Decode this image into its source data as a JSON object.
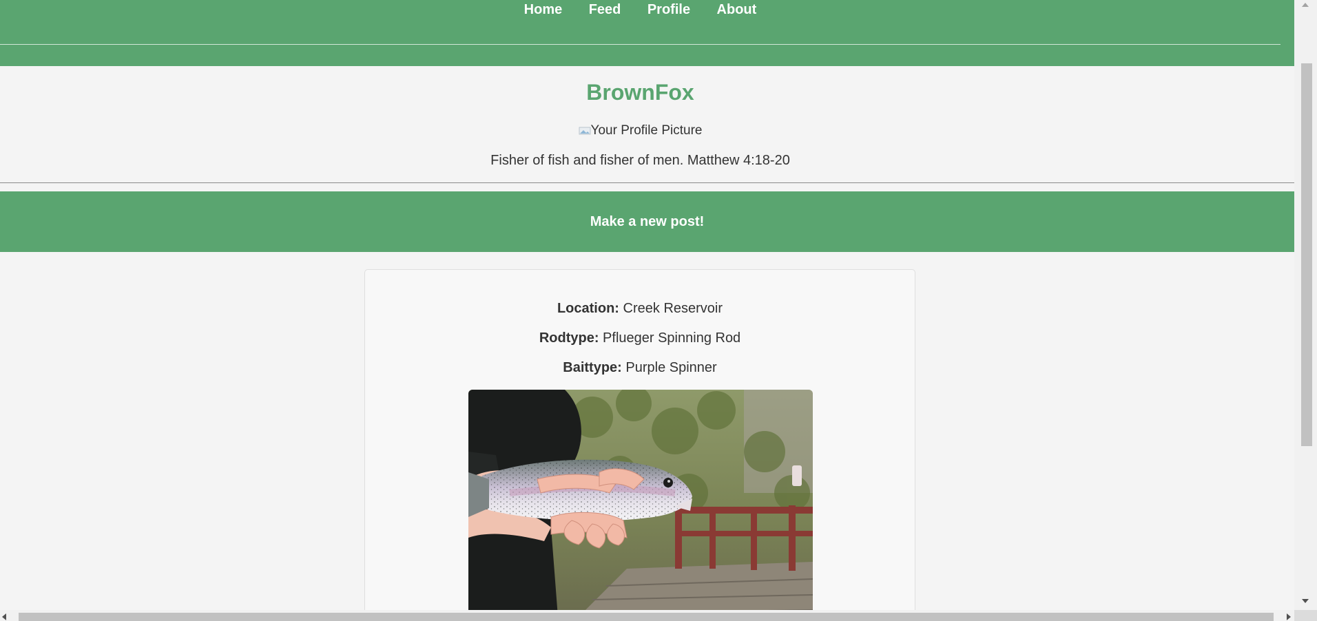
{
  "nav": {
    "items": [
      {
        "label": "Home"
      },
      {
        "label": "Feed"
      },
      {
        "label": "Profile"
      },
      {
        "label": "About"
      }
    ]
  },
  "profile": {
    "username": "BrownFox",
    "picture_alt": "Your Profile Picture",
    "bio": "Fisher of fish and fisher of men. Matthew 4:18-20"
  },
  "new_post_label": "Make a new post!",
  "post": {
    "location_label": "Location:",
    "location": "Creek Reservoir",
    "rodtype_label": "Rodtype:",
    "rodtype": "Pflueger Spinning Rod",
    "baittype_label": "Baittype:",
    "baittype": "Purple Spinner",
    "photo_icon": "trout-catch-photo"
  },
  "colors": {
    "accent": "#5aa570",
    "background": "#f4f4f4",
    "card": "#f8f8f8"
  }
}
